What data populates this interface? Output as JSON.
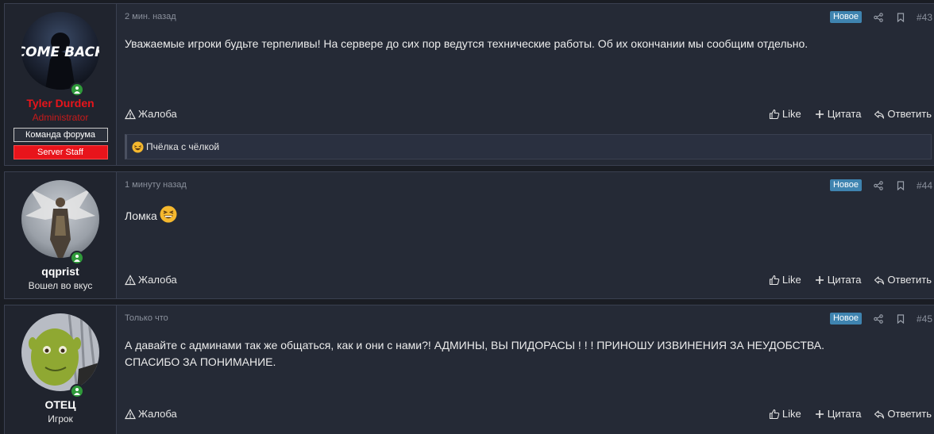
{
  "posts": [
    {
      "author": "Tyler Durden",
      "title": "Administrator",
      "avatar_text": "COME BACK",
      "badges": [
        "Команда форума",
        "Server Staff"
      ],
      "time": "2 мин. назад",
      "new_label": "Новое",
      "number": "#43",
      "body": "Уважаемые игроки будьте терпеливы! На сервере до сих пор ведутся технические работы. Об их окончании мы сообщим отдельно.",
      "report_label": "Жалоба",
      "like_label": "Like",
      "quote_label": "Цитата",
      "reply_label": "Ответить",
      "reactions_text": "Пчёлка с чёлкой"
    },
    {
      "author": "qqprist",
      "title": "Вошел во вкус",
      "time": "1 минуту назад",
      "new_label": "Новое",
      "number": "#44",
      "body": "Ломка",
      "report_label": "Жалоба",
      "like_label": "Like",
      "quote_label": "Цитата",
      "reply_label": "Ответить"
    },
    {
      "author": "ОТЕЦ",
      "title": "Игрок",
      "time": "Только что",
      "new_label": "Новое",
      "number": "#45",
      "body_line1": "А давайте с админами так же общаться, как и они с нами?! АДМИНЫ, ВЫ ПИДОРАСЫ ! ! ! ПРИНОШУ ИЗВИНЕНИЯ ЗА НЕУДОБСТВА.",
      "body_line2": "СПАСИБО ЗА ПОНИМАНИЕ.",
      "report_label": "Жалоба",
      "like_label": "Like",
      "quote_label": "Цитата",
      "reply_label": "Ответить"
    }
  ],
  "colors": {
    "admin_name": "#e8141b",
    "admin_title": "#c81a1a",
    "new_badge": "#3f84b0",
    "online": "#2f9a3a"
  }
}
